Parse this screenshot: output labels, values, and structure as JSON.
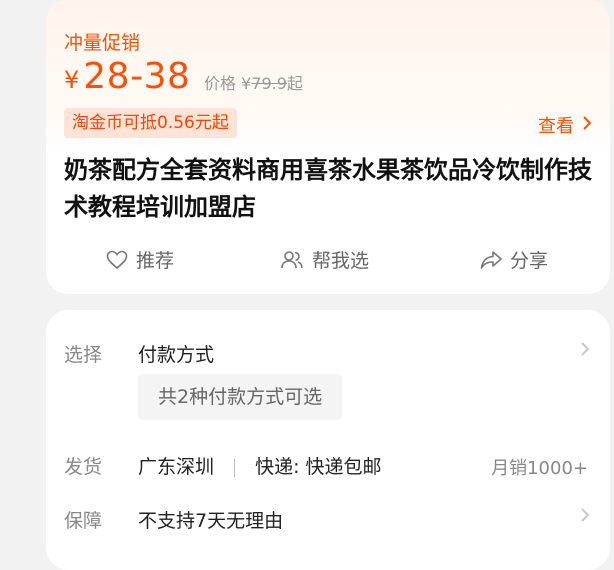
{
  "promo": {
    "label": "冲量促销",
    "currency": "¥",
    "price_range": "28-38",
    "orig_prefix": "价格",
    "orig_currency": "¥",
    "orig_price": "79.9",
    "orig_suffix": "起"
  },
  "coin_badge": "淘金币可抵0.56元起",
  "see_link": "查看",
  "title": "奶茶配方全套资料商用喜茶水果茶饮品冷饮制作技术教程培训加盟店",
  "actions": {
    "recommend": "推荐",
    "help_choose": "帮我选",
    "share": "分享"
  },
  "select_row": {
    "label": "选择",
    "value": "付款方式",
    "chip": "共2种付款方式可选"
  },
  "ship_row": {
    "label": "发货",
    "location": "广东深圳",
    "express": "快递: 快递包邮",
    "sales": "月销1000+"
  },
  "guarantee_row": {
    "label": "保障",
    "value": "不支持7天无理由"
  },
  "colors": {
    "accent": "#ff5000",
    "badge_bg": "#ffe3d6",
    "page_bg": "#f2f2f2"
  },
  "icons": {
    "recommend": "heart-icon",
    "help_choose": "users-icon",
    "share": "share-arrow-icon",
    "chevron": "chevron-right-icon"
  }
}
